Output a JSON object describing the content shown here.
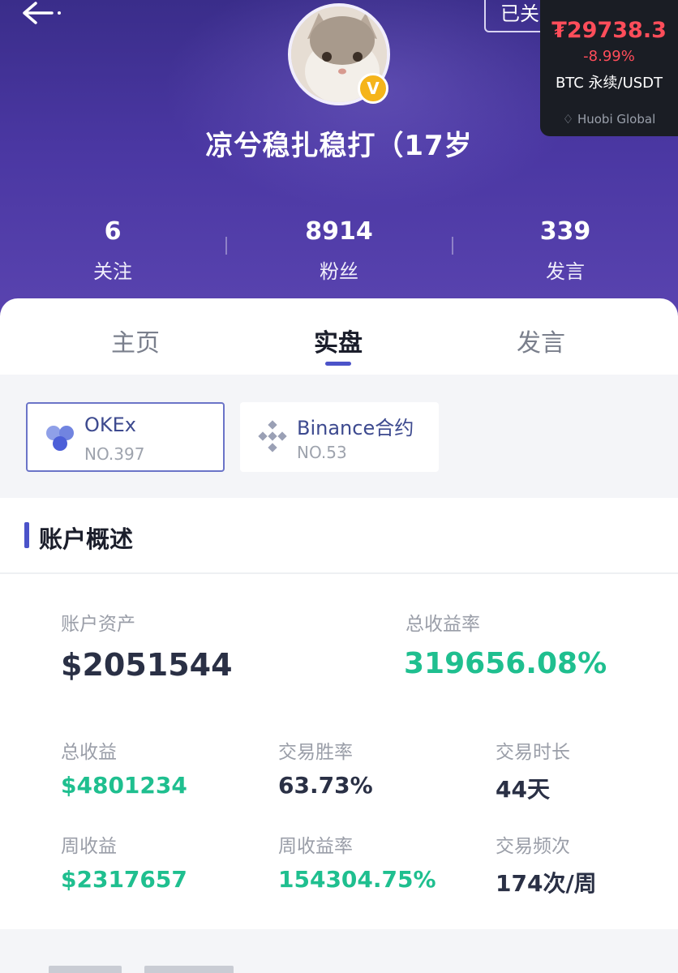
{
  "header": {
    "back_icon": "back-arrow-icon",
    "follow_label": "已关注",
    "more_icon": "more-dots-icon",
    "username": "凉兮稳扎稳打（17岁",
    "verified_badge": "V",
    "stats": [
      {
        "value": "6",
        "label": "关注"
      },
      {
        "value": "8914",
        "label": "粉丝"
      },
      {
        "value": "339",
        "label": "发言"
      }
    ],
    "colors": {
      "gradient_top": "#3a2d8a",
      "gradient_bottom": "#5a44b0"
    }
  },
  "ticker": {
    "price": "₮29738.3",
    "change": "-8.99%",
    "pair": "BTC 永续/USDT",
    "brand": "Huobi Global",
    "price_color": "#ff4d5a"
  },
  "tabs": [
    {
      "label": "主页",
      "active": false
    },
    {
      "label": "实盘",
      "active": true
    },
    {
      "label": "发言",
      "active": false
    }
  ],
  "exchanges": [
    {
      "name": "OKEx",
      "rank": "NO.397",
      "selected": true,
      "icon": "okex-logo-icon"
    },
    {
      "name": "Binance合约",
      "rank": "NO.53",
      "selected": false,
      "icon": "binance-logo-icon"
    }
  ],
  "overview": {
    "title": "账户概述",
    "account_assets_label": "账户资产",
    "account_assets_value": "$2051544",
    "total_return_rate_label": "总收益率",
    "total_return_rate_value": "319656.08%",
    "total_profit_label": "总收益",
    "total_profit_value": "$4801234",
    "win_rate_label": "交易胜率",
    "win_rate_value": "63.73%",
    "duration_label": "交易时长",
    "duration_value": "44天",
    "weekly_profit_label": "周收益",
    "weekly_profit_value": "$2317657",
    "weekly_return_rate_label": "周收益率",
    "weekly_return_rate_value": "154304.75%",
    "frequency_label": "交易频次",
    "frequency_value": "174次/周"
  },
  "accent_color": "#4b53c9",
  "positive_color": "#1fbf8f"
}
